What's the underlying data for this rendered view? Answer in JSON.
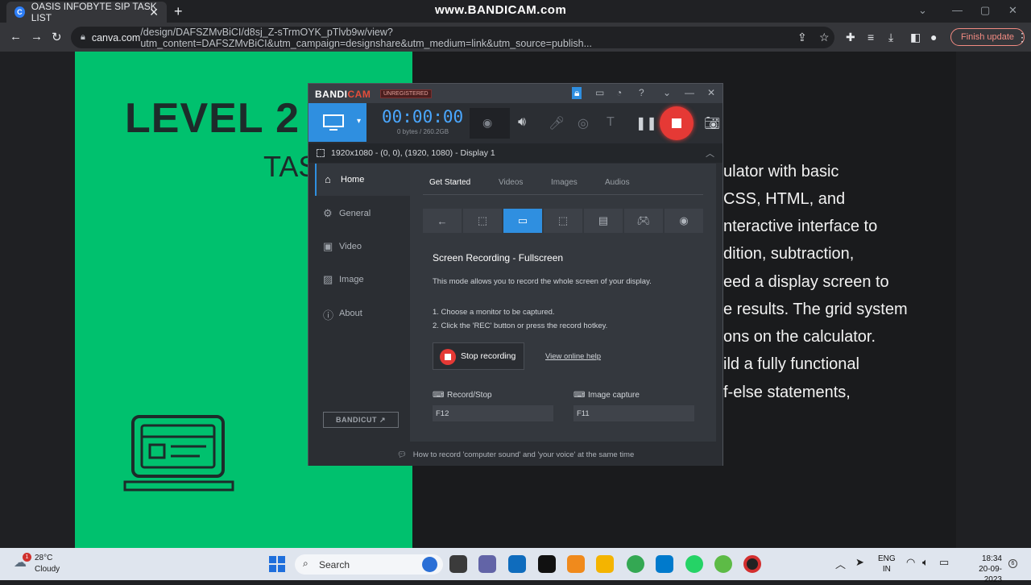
{
  "browser": {
    "tab_title": "OASIS INFOBYTE SIP TASK LIST",
    "tab_favicon": "C",
    "watermark": "www.BANDICAM.com",
    "url_host": "canva.com",
    "url_path": "/design/DAFSZMvBiCI/d8sj_Z-sTrmOYK_pTlvb9w/view?utm_content=DAFSZMvBiCI&utm_campaign=designshare&utm_medium=link&utm_source=publish...",
    "finish_update": "Finish update"
  },
  "slide": {
    "title": "LEVEL 2",
    "subtitle": "TAS",
    "description_lines": [
      "ulator with basic",
      "CSS, HTML, and",
      "nteractive interface to",
      "dition, subtraction,",
      "eed a  display screen to",
      "e results. The grid system",
      "ons on the calculator.",
      "ild a fully functional",
      "f-else statements,"
    ]
  },
  "bandicam": {
    "logo_a": "BANDI",
    "logo_b": "CAM",
    "unregistered": "UNREGISTERED",
    "timer": "00:00:00",
    "bytes": "0 bytes / 260.2GB",
    "display_info": "1920x1080 - (0, 0), (1920, 1080) - Display 1",
    "nav": [
      "Home",
      "General",
      "Video",
      "Image",
      "About"
    ],
    "bandicut": "BANDICUT ↗",
    "tabs": [
      "Get Started",
      "Videos",
      "Images",
      "Audios"
    ],
    "heading": "Screen Recording - Fullscreen",
    "mode_desc": "This mode allows you to record the whole screen of your display.",
    "step1": "1. Choose a monitor to be captured.",
    "step2": "2. Click the 'REC' button or press the record hotkey.",
    "stop_label": "Stop recording",
    "help_link": "View online help",
    "hotkey_rec_label": "Record/Stop",
    "hotkey_rec_value": "F12",
    "hotkey_img_label": "Image capture",
    "hotkey_img_value": "F11",
    "footer": "How to record 'computer sound' and 'your voice' at the same time",
    "accent": "#2f8fe0",
    "rec_color": "#e53935"
  },
  "taskbar": {
    "weather_badge": "1",
    "temp": "28°C",
    "condition": "Cloudy",
    "search": "Search",
    "lang_top": "ENG",
    "lang_bottom": "IN",
    "time": "18:34",
    "date": "20-09-2023",
    "notifications": "6"
  }
}
